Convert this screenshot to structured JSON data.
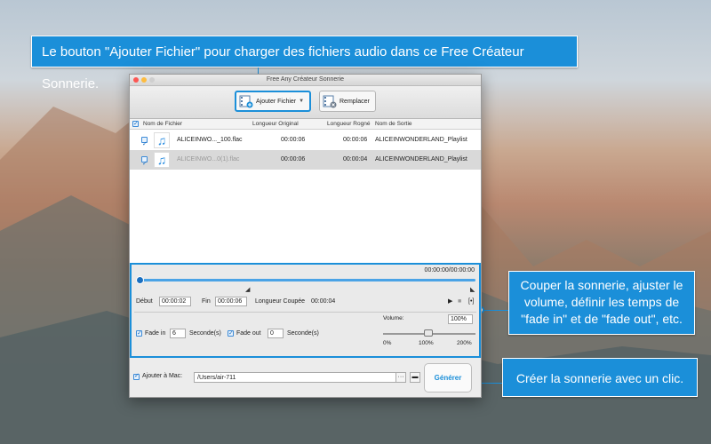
{
  "callouts": {
    "top": "Le bouton \"Ajouter Fichier\" pour charger des fichiers audio dans ce Free Créateur Sonnerie.",
    "right_line1": "Couper la sonnerie, ajuster le",
    "right_line2": "volume, définir les temps de",
    "right_line3": "\"fade in\" et de \"fade out\", etc.",
    "bottom": "Créer la sonnerie avec un clic."
  },
  "window": {
    "title": "Free Any Créateur Sonnerie"
  },
  "toolbar": {
    "add_label": "Ajouter Fichier",
    "replace_label": "Remplacer"
  },
  "table": {
    "headers": {
      "name": "Nom de Fichier",
      "original": "Longueur Original",
      "cut": "Longueur Rogné",
      "output": "Nom de Sortie"
    },
    "rows": [
      {
        "name": "ALICEINWO..._100.flac",
        "original": "00:00:06",
        "cut": "00:00:06",
        "output": "ALICEINWONDERLAND_Playlist"
      },
      {
        "name": "ALICEINWO...0(1).flac",
        "original": "00:00:06",
        "cut": "00:00:04",
        "output": "ALICEINWONDERLAND_Playlist"
      }
    ]
  },
  "editor": {
    "timecode": "00:00:00/00:00:00",
    "start_label": "Début",
    "start_value": "00:00:02",
    "end_label": "Fin",
    "end_value": "00:00:06",
    "cut_length_label": "Longueur Coupée",
    "cut_length_value": "00:00:04",
    "fade_in_label": "Fade in",
    "fade_in_value": "6",
    "seconds_label": "Seconde(s)",
    "fade_out_label": "Fade out",
    "fade_out_value": "0",
    "volume_label": "Volume:",
    "volume_value": "100%",
    "volume_min": "0%",
    "volume_mid": "100%",
    "volume_max": "200%"
  },
  "bottom": {
    "add_to_mac_label": "Ajouter à Mac:",
    "path_value": "/Users/air-711",
    "generate_label": "Générer"
  },
  "colors": {
    "accent": "#1b8fd9"
  }
}
